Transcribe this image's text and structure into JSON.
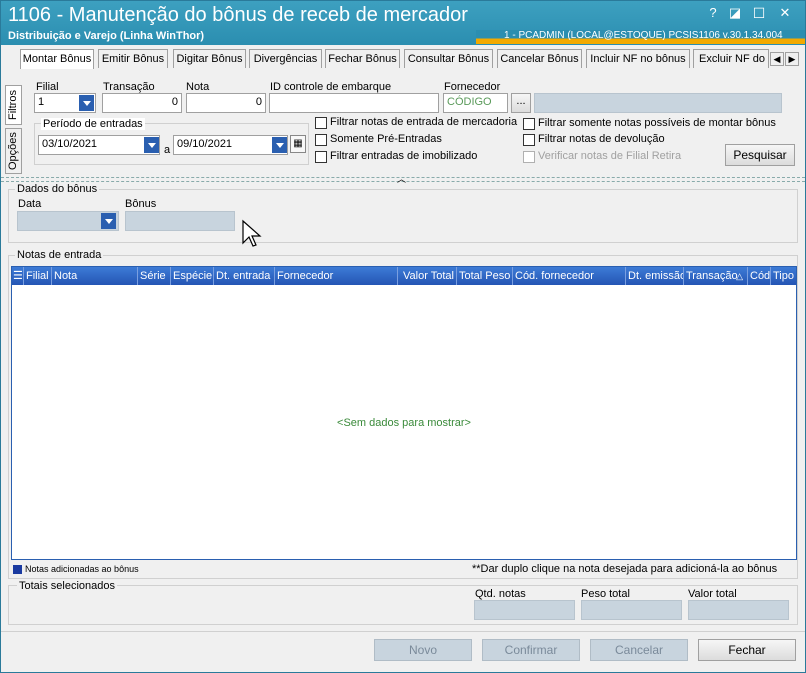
{
  "window": {
    "title": "1106 - Manutenção do bônus de receb de mercador",
    "subtitle": "Distribuição e Varejo (Linha WinThor)",
    "user_info": "1 - PCADMIN (LOCAL@ESTOQUE)   PCSIS1106  v.30.1.34.004",
    "controls": [
      "?",
      "◪",
      "☐",
      "✕"
    ]
  },
  "tabs": [
    "Montar Bônus",
    "Emitir Bônus",
    "Digitar Bônus",
    "Divergências",
    "Fechar Bônus",
    "Consultar Bônus",
    "Cancelar Bônus",
    "Incluir NF no bônus",
    "Excluir NF do b"
  ],
  "side_tabs": [
    "Filtros",
    "Opções"
  ],
  "filters": {
    "filial_label": "Filial",
    "filial_value": "1",
    "transacao_label": "Transação",
    "transacao_value": "0",
    "nota_label": "Nota",
    "nota_value": "0",
    "id_label": "ID controle de embarque",
    "id_value": "",
    "fornecedor_label": "Fornecedor",
    "fornecedor_code": "CÓDIGO",
    "fornecedor_btn": "...",
    "fornecedor_name": "",
    "periodo_label": "Período de entradas",
    "date_from": "03/10/2021",
    "date_sep": "a",
    "date_to": "09/10/2021",
    "checks": [
      "Filtrar notas de entrada de mercadoria",
      "Somente Pré-Entradas",
      "Filtrar entradas de imobilizado",
      "Filtrar somente notas possíveis de montar bônus",
      "Filtrar notas de devolução",
      "Verificar notas de Filial Retira"
    ],
    "search_btn": "Pesquisar"
  },
  "bonus": {
    "group_label": "Dados do bônus",
    "data_label": "Data",
    "bonus_label": "Bônus"
  },
  "notas": {
    "group_label": "Notas de entrada",
    "columns": [
      "Filial",
      "Nota",
      "Série",
      "Espécie",
      "Dt. entrada",
      "Fornecedor",
      "Valor Total",
      "Total Peso",
      "Cód. fornecedor",
      "Dt. emissão",
      "Transação",
      "Cód",
      "Tipo"
    ],
    "empty_text": "<Sem dados para mostrar>",
    "legend": "Notas adicionadas ao bônus",
    "hint": "**Dar duplo clique na nota desejada para adicioná-la ao bônus",
    "colors": {
      "header": "#2a5fb0",
      "legend": "#1a3aa0",
      "empty_text": "#3a8a3a"
    }
  },
  "totais": {
    "group_label": "Totais selecionados",
    "qtd_label": "Qtd. notas",
    "peso_label": "Peso total",
    "valor_label": "Valor total"
  },
  "footer": {
    "novo": "Novo",
    "confirmar": "Confirmar",
    "cancelar": "Cancelar",
    "fechar": "Fechar"
  }
}
